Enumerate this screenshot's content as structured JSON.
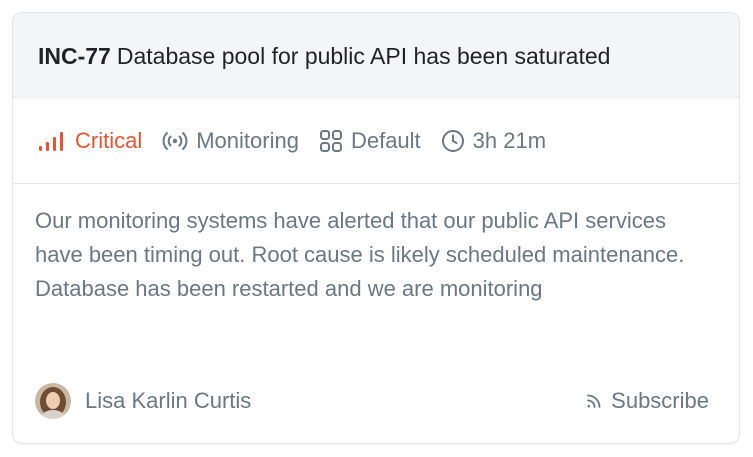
{
  "incident": {
    "reference": "INC-77",
    "title": "Database pool for public API has been saturated",
    "severity": "Critical",
    "status": "Monitoring",
    "type": "Default",
    "duration": "3h 21m",
    "description": "Our monitoring systems have alerted that our public API services have been timing out. Root cause is likely scheduled maintenance. Database has been restarted and we are monitoring",
    "lead_name": "Lisa Karlin Curtis",
    "subscribe_label": "Subscribe"
  },
  "icons": {
    "severity": "signal-bars-icon",
    "status": "broadcast-icon",
    "type": "grid-icon",
    "duration": "clock-icon",
    "subscribe": "rss-icon"
  },
  "colors": {
    "critical": "#e8542d",
    "muted_text": "#6b7785",
    "header_bg": "#f4f5f7",
    "title_text": "#1f2328"
  }
}
